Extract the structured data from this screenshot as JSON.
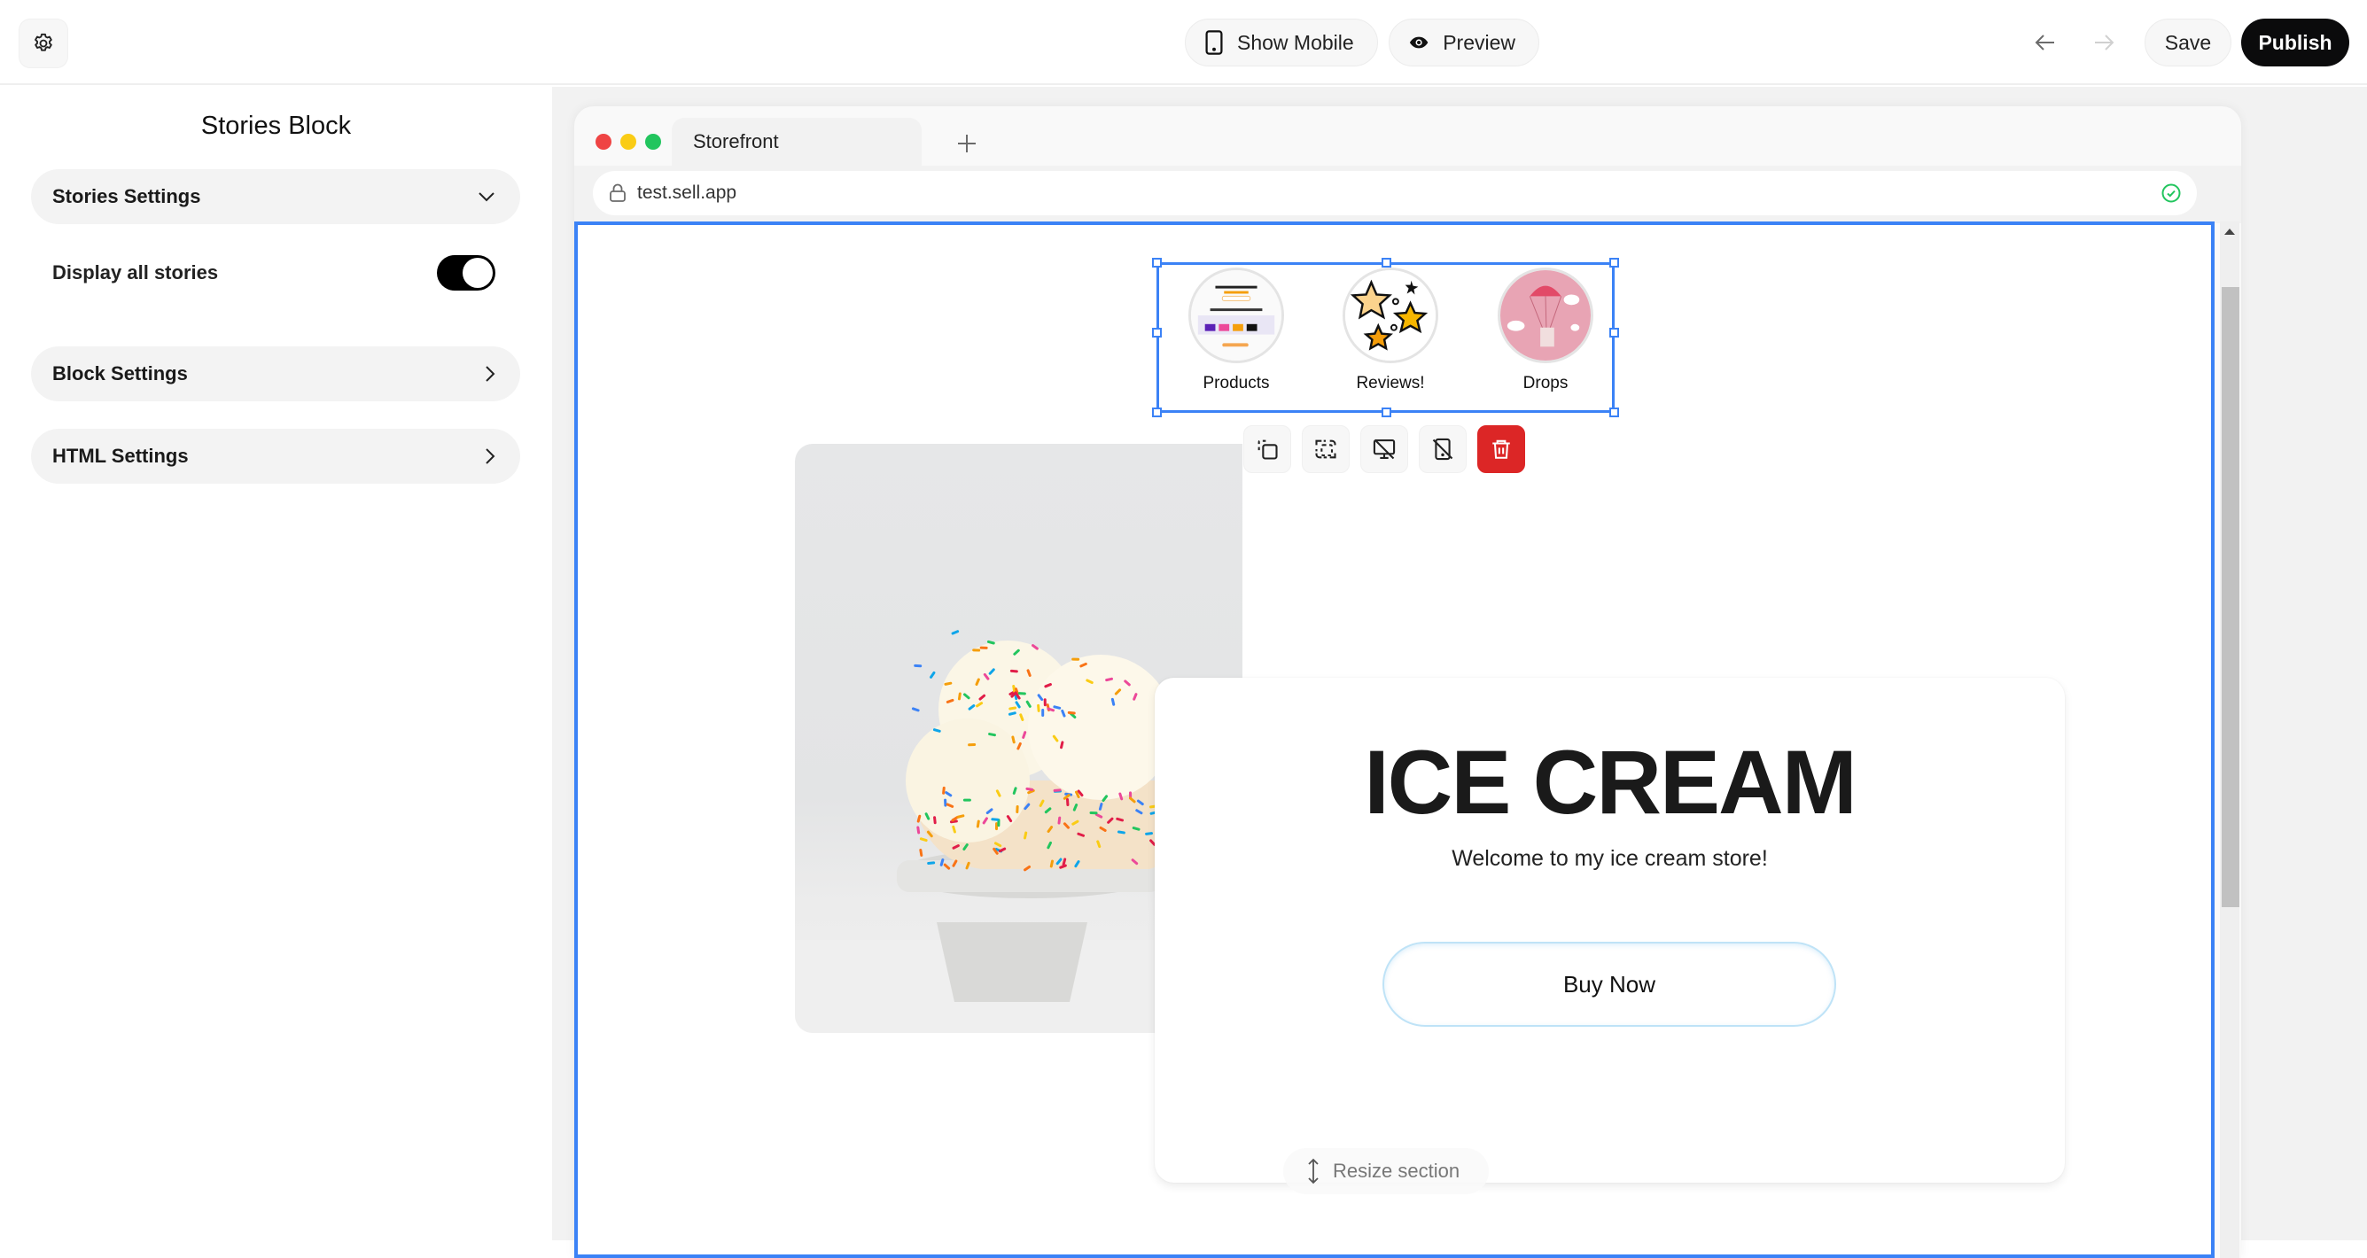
{
  "topbar": {
    "settings_icon": "gear-icon",
    "show_mobile_label": "Show Mobile",
    "show_mobile_icon": "phone-icon",
    "preview_label": "Preview",
    "preview_icon": "eye-icon",
    "undo_icon": "arrow-left-icon",
    "redo_icon": "arrow-right-icon",
    "save_label": "Save",
    "publish_label": "Publish"
  },
  "sidebar": {
    "title": "Stories Block",
    "sections": [
      {
        "label": "Stories Settings",
        "state": "expanded",
        "icon": "chevron-down-icon"
      },
      {
        "label": "Block Settings",
        "state": "collapsed",
        "icon": "chevron-right-icon"
      },
      {
        "label": "HTML Settings",
        "state": "collapsed",
        "icon": "chevron-right-icon"
      }
    ],
    "display_all_stories": {
      "label": "Display all stories",
      "checked": true
    }
  },
  "browser": {
    "tab_title": "Storefront",
    "url": "test.sell.app",
    "secure_status": "verified"
  },
  "stories": [
    {
      "label": "Products",
      "thumb": "storefront-screenshot"
    },
    {
      "label": "Reviews!",
      "thumb": "stars-illustration"
    },
    {
      "label": "Drops",
      "thumb": "parachute-box"
    }
  ],
  "block_toolbar": [
    {
      "name": "duplicate-button",
      "icon": "duplicate-icon"
    },
    {
      "name": "select-parent-button",
      "icon": "select-frame-icon"
    },
    {
      "name": "hide-desktop-button",
      "icon": "monitor-off-icon"
    },
    {
      "name": "hide-mobile-button",
      "icon": "phone-off-icon"
    },
    {
      "name": "delete-button",
      "icon": "trash-icon"
    }
  ],
  "hero": {
    "title": "ICE CREAM",
    "subtitle": "Welcome to my ice cream store!",
    "cta_label": "Buy Now",
    "image": "ice-cream-sprinkles-photo"
  },
  "resize_label": "Resize section",
  "colors": {
    "accent": "#3b82f6",
    "danger": "#dc2626",
    "publish": "#0b0b0c",
    "success": "#22c55e"
  }
}
